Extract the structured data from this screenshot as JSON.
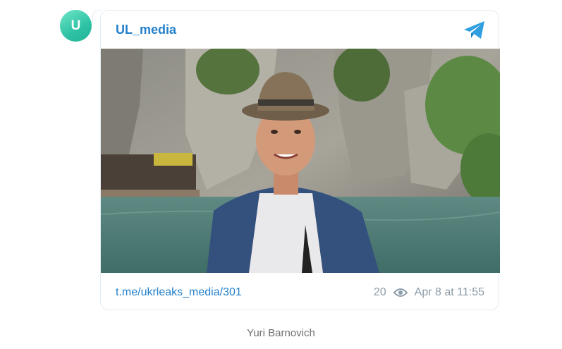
{
  "post": {
    "avatar_letter": "U",
    "channel_name": "UL_media",
    "link": "t.me/ukrleaks_media/301",
    "views": "20",
    "date": "Apr 8 at 11:55",
    "icons": {
      "app": "telegram-plane-icon",
      "views": "eye-icon"
    },
    "colors": {
      "accent": "#2481cc",
      "avatar": "#2ec2a4",
      "meta": "#8b9ba8"
    }
  },
  "caption": "Yuri Barnovich"
}
